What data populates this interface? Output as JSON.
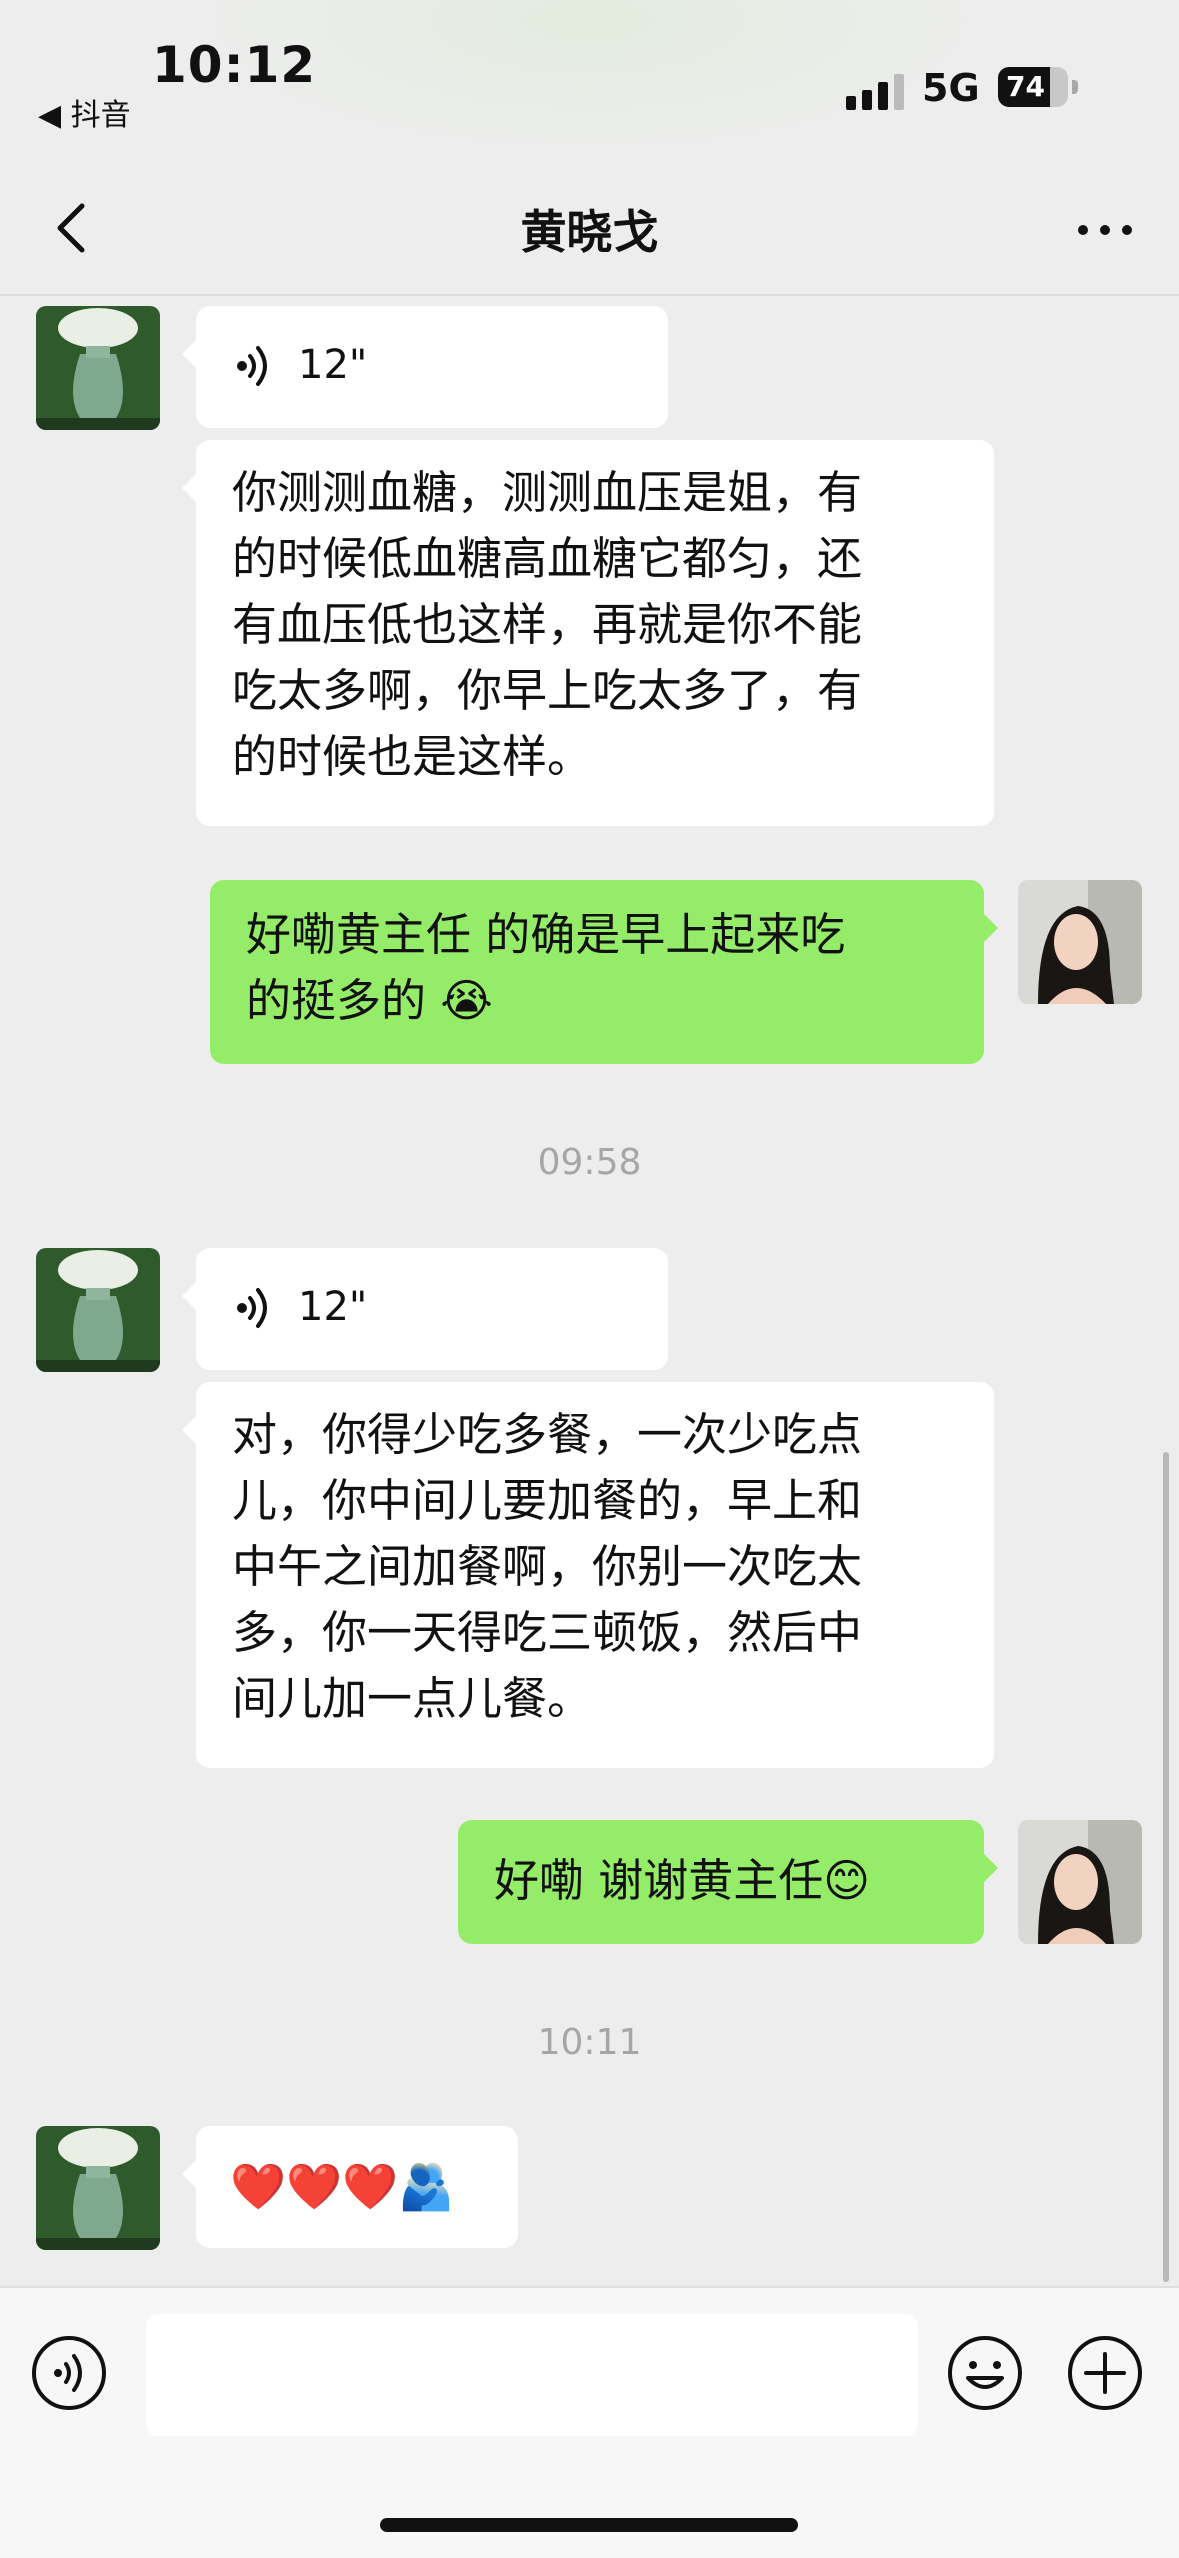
{
  "status_bar": {
    "time": "10:12",
    "back_app": "◀ 抖音",
    "network": "5G",
    "battery": "74"
  },
  "header": {
    "title": "黄晓戈"
  },
  "messages": [
    {
      "side": "in",
      "type": "voice",
      "duration": "12\""
    },
    {
      "side": "in",
      "type": "text",
      "lines": [
        "你测测血糖，测测血压是姐，有",
        "的时候低血糖高血糖它都匀，还",
        "有血压低也这样，再就是你不能",
        "吃太多啊，你早上吃太多了，有",
        "的时候也是这样。"
      ]
    },
    {
      "side": "out",
      "type": "text",
      "lines": [
        "好嘞黄主任  的确是早上起来吃",
        "的挺多的 😭"
      ]
    },
    {
      "type": "timestamp",
      "text": "09:58"
    },
    {
      "side": "in",
      "type": "voice",
      "duration": "12\""
    },
    {
      "side": "in",
      "type": "text",
      "lines": [
        "对，你得少吃多餐，一次少吃点",
        "儿，你中间儿要加餐的，早上和",
        "中午之间加餐啊，你别一次吃太",
        "多，你一天得吃三顿饭，然后中",
        "间儿加一点儿餐。"
      ]
    },
    {
      "side": "out",
      "type": "text",
      "lines": [
        "好嘞  谢谢黄主任😊"
      ]
    },
    {
      "type": "timestamp",
      "text": "10:11"
    },
    {
      "side": "in",
      "type": "text",
      "lines": [
        "❤️❤️❤️🫂"
      ]
    }
  ],
  "input_bar": {
    "placeholder": ""
  },
  "colors": {
    "outgoing_bubble": "#95ec69",
    "incoming_bubble": "#ffffff",
    "background": "#ededed"
  }
}
